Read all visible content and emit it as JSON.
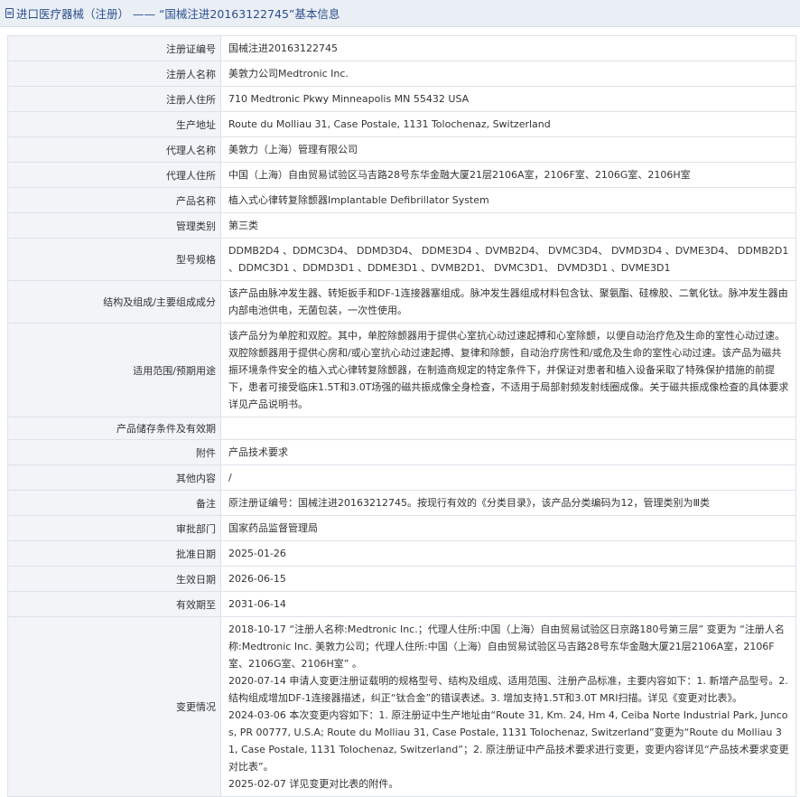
{
  "header": {
    "title": "进口医疗器械（注册） —— “国械注进20163122745”基本信息"
  },
  "rows": [
    {
      "label": "注册证编号",
      "value": "国械注进20163122745"
    },
    {
      "label": "注册人名称",
      "value": "美敦力公司Medtronic Inc."
    },
    {
      "label": "注册人住所",
      "value": "710 Medtronic Pkwy Minneapolis MN 55432 USA"
    },
    {
      "label": "生产地址",
      "value": "Route du Molliau 31, Case Postale, 1131 Tolochenaz, Switzerland"
    },
    {
      "label": "代理人名称",
      "value": "美敦力（上海）管理有限公司"
    },
    {
      "label": "代理人住所",
      "value": "中国（上海）自由贸易试验区马吉路28号东华金融大厦21层2106A室，2106F室、2106G室、2106H室"
    },
    {
      "label": "产品名称",
      "value": "植入式心律转复除颤器Implantable Defibrillator System"
    },
    {
      "label": "管理类别",
      "value": "第三类"
    },
    {
      "label": "型号规格",
      "value": "DDMB2D4 、DDMC3D4、 DDMD3D4、 DDME3D4 、DVMB2D4、 DVMC3D4、 DVMD3D4 、DVME3D4、 DDMB2D1 、DDMC3D1 、DDMD3D1 、DDME3D1 、DVMB2D1、 DVMC3D1、 DVMD3D1 、DVME3D1"
    },
    {
      "label": "结构及组成/主要组成成分",
      "value": "该产品由脉冲发生器、转矩扳手和DF-1连接器塞组成。脉冲发生器组成材料包含钛、聚氨酯、硅橡胶、二氧化钛。脉冲发生器由内部电池供电，无菌包装，一次性使用。"
    },
    {
      "label": "适用范围/预期用途",
      "value": "该产品分为单腔和双腔。其中，单腔除颤器用于提供心室抗心动过速起搏和心室除颤，以便自动治疗危及生命的室性心动过速。双腔除颤器用于提供心房和/或心室抗心动过速起搏、复律和除颤，自动治疗房性和/或危及生命的室性心动过速。该产品为磁共振环境条件安全的植入式心律转复除颤器，在制造商规定的特定条件下，并保证对患者和植入设备采取了特殊保护措施的前提下，患者可接受临床1.5T和3.0T场强的磁共振成像全身检查，不适用于局部射频发射线圈成像。关于磁共振成像检查的具体要求详见产品说明书。"
    },
    {
      "label": "产品储存条件及有效期",
      "value": ""
    },
    {
      "label": "附件",
      "value": "产品技术要求"
    },
    {
      "label": "其他内容",
      "value": "/"
    },
    {
      "label": "备注",
      "value": "原注册证编号：国械注进20163212745。按现行有效的《分类目录》，该产品分类编码为12，管理类别为Ⅲ类"
    },
    {
      "label": "审批部门",
      "value": "国家药品监督管理局"
    },
    {
      "label": "批准日期",
      "value": "2025-01-26"
    },
    {
      "label": "生效日期",
      "value": "2026-06-15"
    },
    {
      "label": "有效期至",
      "value": "2031-06-14"
    }
  ],
  "changes": {
    "label": "变更情况",
    "entries": [
      "2018-10-17 “注册人名称:Medtronic Inc.；代理人住所:中国（上海）自由贸易试验区日京路180号第三层” 变更为 “注册人名称:Medtronic Inc. 美敦力公司；代理人住所:中国（上海）自由贸易试验区马吉路28号东华金融大厦21层2106A室，2106F室、2106G室、2106H室” 。",
      "2020-07-14 申请人变更注册证载明的规格型号、结构及组成、适用范围、注册产品标准，主要内容如下：1. 新增产品型号。2. 结构组成增加DF-1连接器描述，纠正“钛合金”的错误表述。3. 增加支持1.5T和3.0T MRI扫描。详见《变更对比表》。",
      "2024-03-06 本次变更内容如下：1. 原注册证中生产地址由“Route 31, Km. 24, Hm 4, Ceiba Norte Industrial Park, Juncos, PR 00777, U.S.A; Route du Molliau 31, Case Postale, 1131 Tolochenaz, Switzerland”变更为“Route du Molliau 31, Case Postale, 1131 Tolochenaz, Switzerland”；2. 原注册证中产品技术要求进行变更，变更内容详见“产品技术要求变更对比表”。",
      "2025-02-07 详见变更对比表的附件。"
    ]
  }
}
